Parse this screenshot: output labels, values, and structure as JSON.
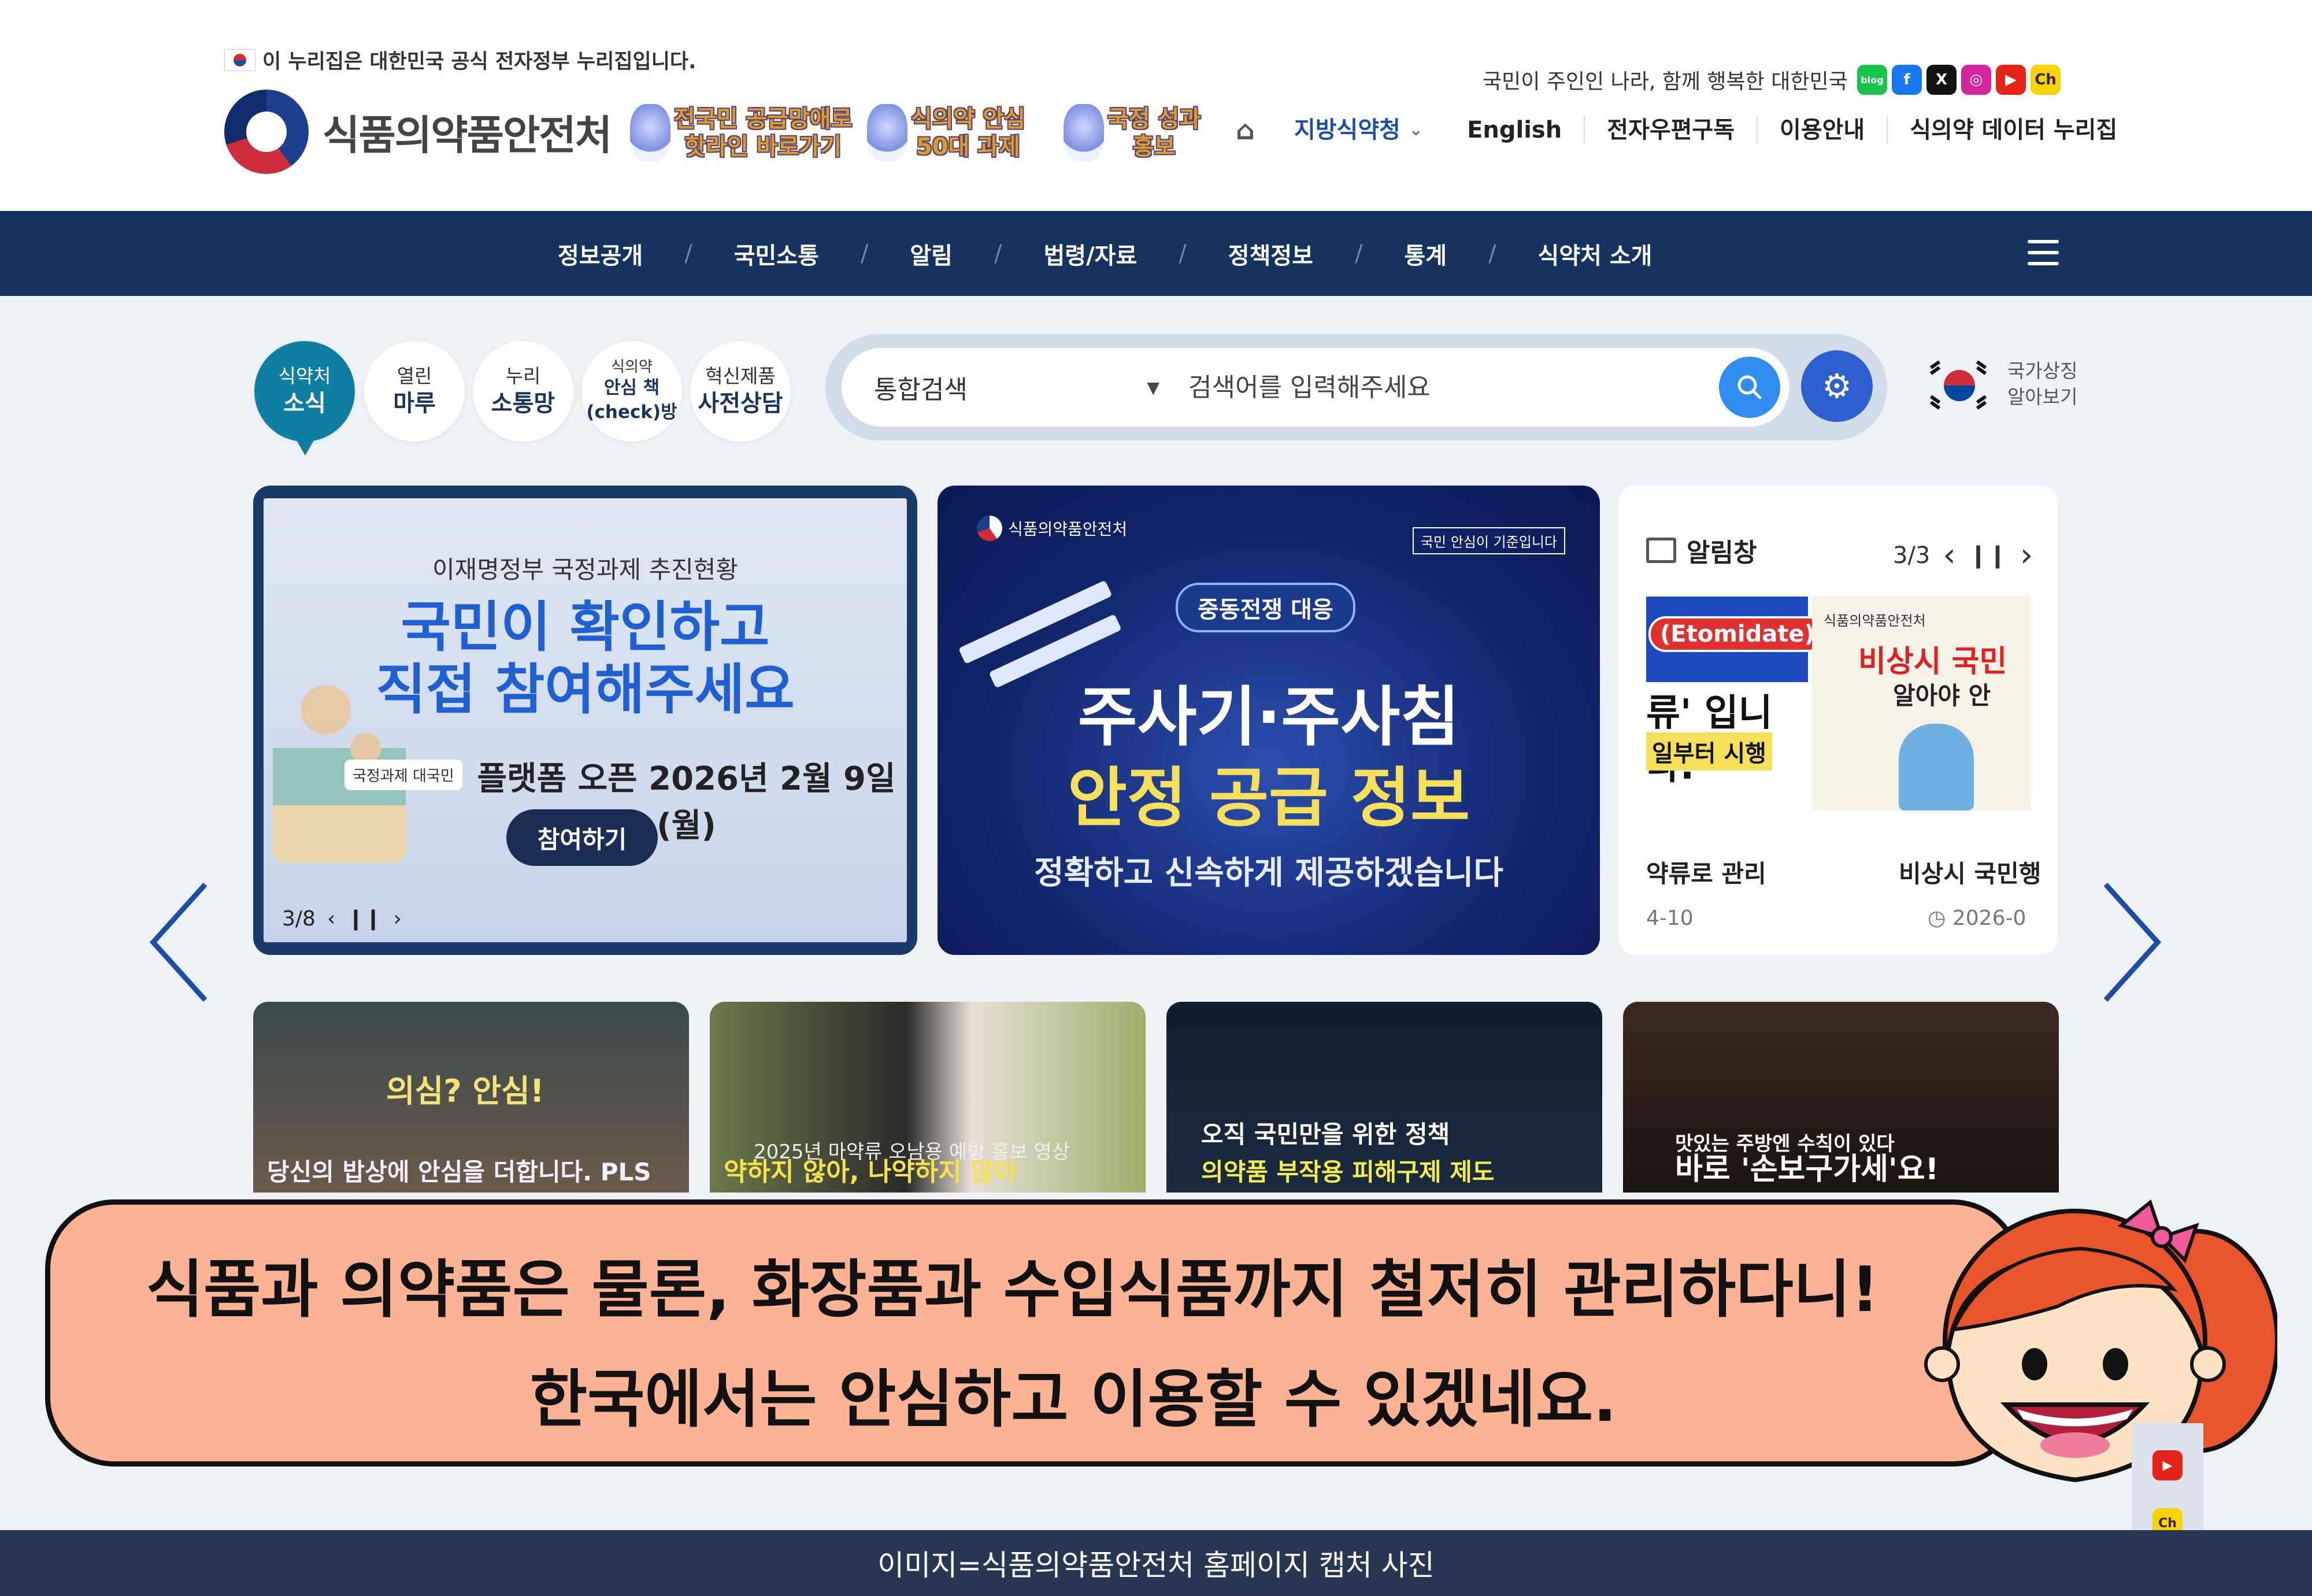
{
  "header": {
    "gov_notice": "이 누리집은 대한민국 공식 전자정부 누리집입니다.",
    "logo_text": "식품의약품안전처",
    "promos": [
      {
        "line1": "전국민 공급망애로",
        "line2": "핫라인 바로가기"
      },
      {
        "line1": "식의약 안심",
        "line2": "50대 과제"
      },
      {
        "line1": "국정 성과",
        "line2": "홍보"
      }
    ],
    "slogan": "국민이 주인인 나라, 함께 행복한 대한민국",
    "social": [
      {
        "name": "blog-icon",
        "label": "blog",
        "color": "#19c44d"
      },
      {
        "name": "facebook-icon",
        "label": "f",
        "color": "#1877f2"
      },
      {
        "name": "x-icon",
        "label": "X",
        "color": "#111111"
      },
      {
        "name": "instagram-icon",
        "label": "◎",
        "color": "#d6249f"
      },
      {
        "name": "youtube-icon",
        "label": "▶",
        "color": "#e62117"
      },
      {
        "name": "kakao-icon",
        "label": "Ch",
        "color": "#f7d600"
      }
    ],
    "utility": {
      "regional": "지방식약청",
      "english": "English",
      "newsletter": "전자우편구독",
      "guide": "이용안내",
      "data_portal": "식의약 데이터 누리집"
    }
  },
  "nav": {
    "items": [
      "정보공개",
      "국민소통",
      "알림",
      "법령/자료",
      "정책정보",
      "통계",
      "식약처 소개"
    ]
  },
  "quick_tabs": [
    {
      "line1": "식약처",
      "line2": "소식"
    },
    {
      "line1": "열린",
      "line2": "마루"
    },
    {
      "line1": "누리",
      "line2": "소통망"
    },
    {
      "line1": "식의약",
      "line2": "안심 책\n(check)방"
    },
    {
      "line1": "혁신제품",
      "line2": "사전상담"
    }
  ],
  "search": {
    "scope": "통합검색",
    "placeholder": "검색어를 입력해주세요"
  },
  "symbol_link": {
    "line1": "국가상징",
    "line2": "알아보기"
  },
  "banner1": {
    "subtitle": "이재명정부 국정과제 추진현황",
    "title_line1": "국민이 확인하고",
    "title_line2": "직접 참여해주세요",
    "tag": "국정과제 대국민",
    "open_text": "플랫폼 오픈 2026년 2월 9일(월)",
    "button": "참여하기",
    "counter": "3/8"
  },
  "banner2": {
    "logo": "식품의약품안전처",
    "tagline": "국민 안심이 기준입니다",
    "badge": "중동전쟁 대응",
    "line1": "주사기·주사침",
    "line2": "안정 공급 정보",
    "line3": "정확하고 신속하게 제공하겠습니다"
  },
  "alert": {
    "title": "알림창",
    "counter": "3/3",
    "img1_pill": "(Etomidate)",
    "img1_line2": "류' 입니다.",
    "img1_line3": "일부터 시행",
    "img2_header": "식품의약품안전처",
    "img2_line1": "비상시 국민",
    "img2_line2": "알아야 안",
    "caption1": "약류로 관리",
    "caption2": "비상시 국민행",
    "date1": "4-10",
    "date2": "2026-0"
  },
  "videos": [
    {
      "title": "당신의 밥상에 안심을 더합니다. PLS",
      "sub": "의심? 안심!"
    },
    {
      "title": "약하지 않아, 나약하지 않아",
      "sub": "2025년 마약류 오남용 예방 홍보 영상"
    },
    {
      "title": "의약품 부작용 피해구제 제도",
      "sub": "오직 국민만을 위한 정책"
    },
    {
      "title": "바로 '손보구가세'요!",
      "sub": "맛있는 주방엔 수칙이 있다"
    }
  ],
  "speech": {
    "line1": "식품과 의약품은 물론, 화장품과 수입식품까지 철저히 관리하다니!",
    "line2": "한국에서는 안심하고 이용할 수 있겠네요."
  },
  "caption": "이미지=식품의약품안전처 홈페이지 캡처 사진"
}
